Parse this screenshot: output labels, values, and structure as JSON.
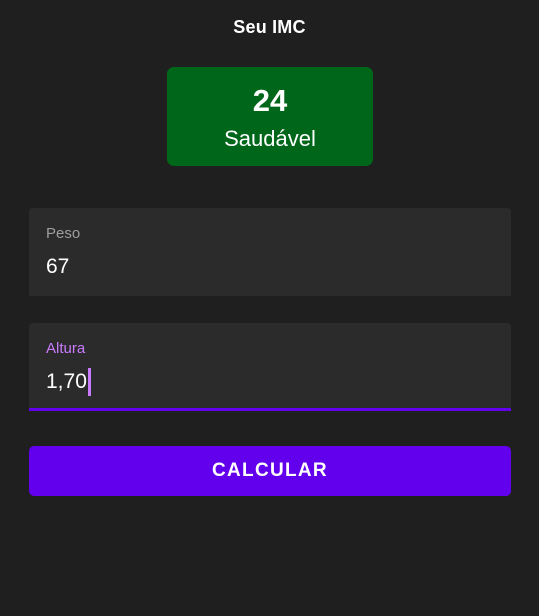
{
  "header": {
    "title": "Seu IMC"
  },
  "result": {
    "value": "24",
    "label": "Saudável",
    "color": "#006619"
  },
  "form": {
    "peso": {
      "label": "Peso",
      "value": "67"
    },
    "altura": {
      "label": "Altura",
      "value": "1,70"
    }
  },
  "actions": {
    "calculate_label": "CALCULAR",
    "accent": "#6200ee"
  }
}
